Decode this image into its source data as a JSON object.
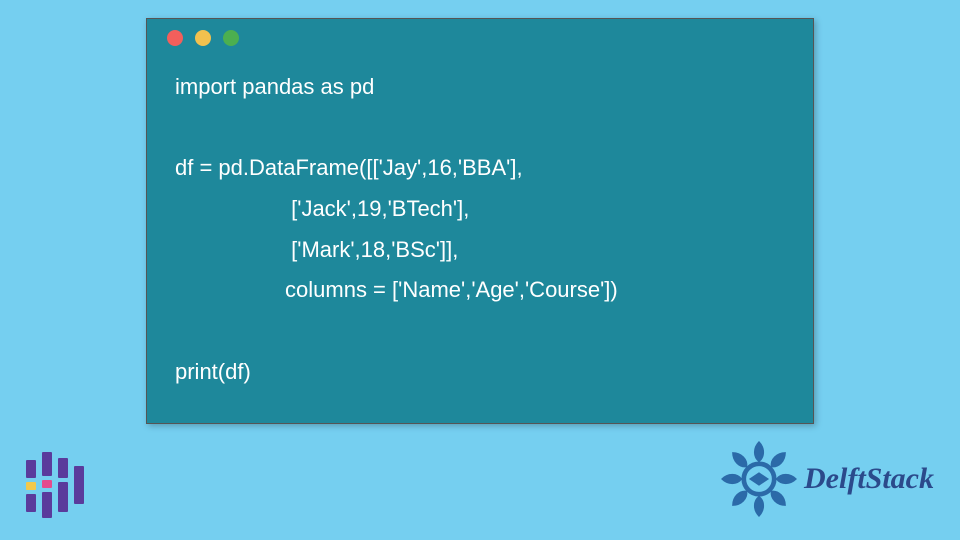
{
  "window": {
    "dots": [
      "red",
      "yellow",
      "green"
    ]
  },
  "code": {
    "line1": "import pandas as pd",
    "line2": "",
    "line3": "df = pd.DataFrame([['Jay',16,'BBA'],",
    "line4": "                   ['Jack',19,'BTech'],",
    "line5": "                   ['Mark',18,'BSc']],",
    "line6": "                  columns = ['Name','Age','Course'])",
    "line7": "",
    "line8": "print(df)"
  },
  "brand": {
    "name": "DelftStack"
  },
  "colors": {
    "background": "#75cff0",
    "window": "#1e889b",
    "brand_blue": "#2b4a8b",
    "logo_purple": "#5a3b9c",
    "logo_pink": "#e54b8c",
    "logo_yellow": "#f2c94c"
  }
}
